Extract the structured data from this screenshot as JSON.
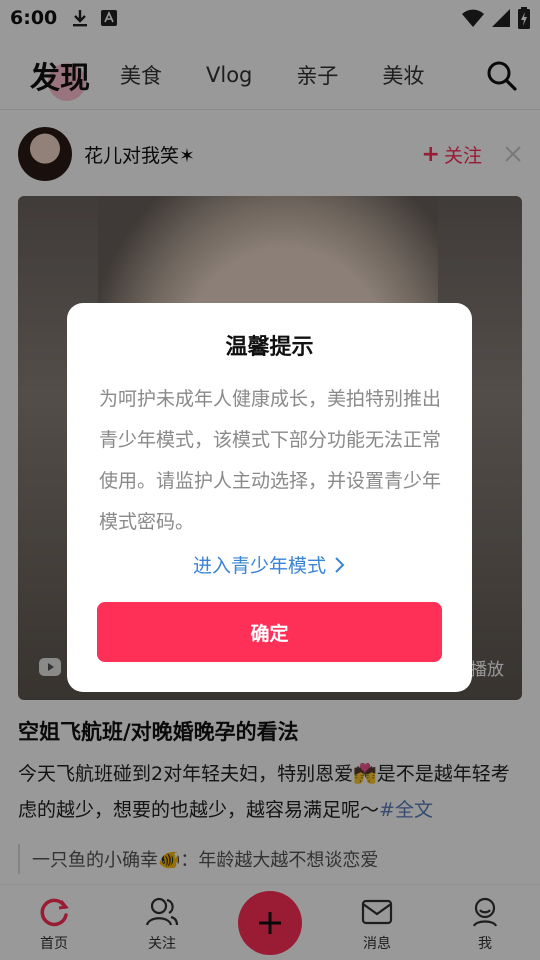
{
  "status_bar": {
    "time": "6:00"
  },
  "top_nav": {
    "title": "发现",
    "tabs": [
      {
        "label": "美食"
      },
      {
        "label": "Vlog"
      },
      {
        "label": "亲子"
      },
      {
        "label": "美妆"
      }
    ],
    "search_icon": "search-icon"
  },
  "post": {
    "author": "花儿对我笑✶",
    "follow_label": "关注",
    "video_play_label": "播放",
    "title": "空姐飞航班/对晚婚晚孕的看法",
    "body_text": "今天飞航班碰到2对年轻夫妇，特别恩爱💏是不是越年轻考虑的越少，想要的也越少，越容易满足呢～",
    "hashtag": "#",
    "full_text_label": "全文",
    "comment": {
      "author": "一只鱼的小确幸🐠",
      "text": "年龄越大越不想谈恋爱"
    }
  },
  "tab_bar": {
    "items": [
      {
        "label": "首页",
        "icon": "home-icon"
      },
      {
        "label": "关注",
        "icon": "follow-icon"
      },
      {
        "label": "",
        "icon": "plus-icon"
      },
      {
        "label": "消息",
        "icon": "message-icon"
      },
      {
        "label": "我",
        "icon": "profile-icon"
      }
    ]
  },
  "dialog": {
    "title": "温馨提示",
    "message": "为呵护未成年人健康成长，美拍特别推出青少年模式，该模式下部分功能无法正常使用。请监护人主动选择，并设置青少年模式密码。",
    "link_label": "进入青少年模式",
    "confirm_label": "确定"
  },
  "colors": {
    "accent": "#ff3058",
    "link": "#3a84d6",
    "dim_overlay": "rgba(0,0,0,0.4)"
  }
}
